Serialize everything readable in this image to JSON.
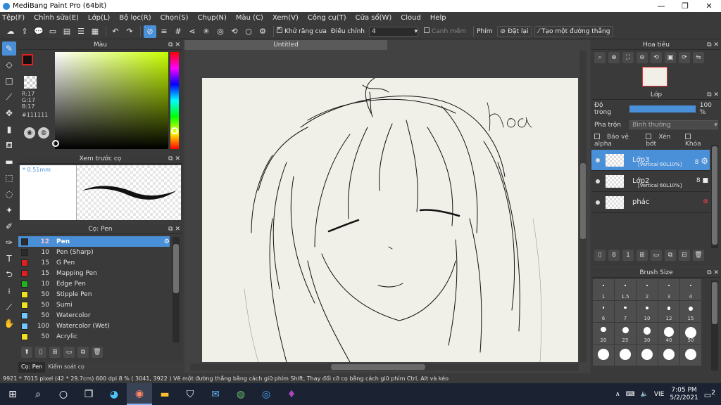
{
  "window": {
    "title": "MediBang Paint Pro (64bit)"
  },
  "menu": [
    "Tệp(F)",
    "Chỉnh sửa(E)",
    "Lớp(L)",
    "Bộ lọc(R)",
    "Chọn(S)",
    "Chụp(N)",
    "Màu (C)",
    "Xem(V)",
    "Công cụ(T)",
    "Cửa sổ(W)",
    "Cloud",
    "Help"
  ],
  "toolbar": {
    "antialias_label": "Khử răng cưa",
    "correction_label": "Điều chỉnh",
    "correction_value": "4",
    "stay_label": "Canh mềm",
    "key_label": "Phím",
    "reset_label": "Đặt lại",
    "line_label": "Tạo một đường thẳng"
  },
  "color_panel": {
    "title": "Màu",
    "r": "R:17",
    "g": "G:17",
    "b": "B:17",
    "hex": "#111111",
    "fg_color": "#111111",
    "bg_color": "#c6d8ff"
  },
  "preview_panel": {
    "title": "Xem trước cọ",
    "size": "* 0.51mm"
  },
  "pen_panel": {
    "title": "Cọ: Pen",
    "items": [
      {
        "num": "12",
        "name": "Pen",
        "color": "#2b2b2b"
      },
      {
        "num": "10",
        "name": "Pen (Sharp)",
        "color": "#2b2b2b"
      },
      {
        "num": "15",
        "name": "G Pen",
        "color": "#e02020"
      },
      {
        "num": "15",
        "name": "Mapping Pen",
        "color": "#e02020"
      },
      {
        "num": "10",
        "name": "Edge Pen",
        "color": "#20b020"
      },
      {
        "num": "50",
        "name": "Stipple Pen",
        "color": "#f0e020"
      },
      {
        "num": "50",
        "name": "Sumi",
        "color": "#f0e020"
      },
      {
        "num": "50",
        "name": "Watercolor",
        "color": "#70c8ff"
      },
      {
        "num": "100",
        "name": "Watercolor (Wet)",
        "color": "#70c8ff"
      },
      {
        "num": "50",
        "name": "Acrylic",
        "color": "#f0e020"
      }
    ]
  },
  "left_tabs": [
    "Cọ: Pen",
    "Kiểm soát cọ"
  ],
  "document": {
    "tab": "Untitled",
    "handwriting": "hoa"
  },
  "navigator": {
    "title": "Hoa tiêu"
  },
  "layer_panel": {
    "title": "Lớp",
    "opacity_label": "Độ trong",
    "opacity_value": "100 %",
    "opacity_fraction": 1.0,
    "blend_label": "Pha trộn",
    "blend_value": "Bình thường",
    "protect_alpha": "Bảo vệ alpha",
    "clipping": "Xén bớt",
    "lock": "Khóa",
    "layers": [
      {
        "name": "Lớp3",
        "sub": "[Vertical 60L10%]",
        "right": "8"
      },
      {
        "name": "Lớp2",
        "sub": "[Vertical 60L10%]",
        "right": "8"
      },
      {
        "name": "phác",
        "sub": "",
        "right": ""
      }
    ]
  },
  "brush_size": {
    "title": "Brush Size",
    "sizes": [
      "1",
      "1.5",
      "2",
      "3",
      "4",
      "6",
      "7",
      "10",
      "12",
      "15",
      "20",
      "25",
      "30",
      "40",
      "50",
      "",
      "",
      "",
      "",
      ""
    ]
  },
  "status": "9921 * 7015 pixel   (42 * 29.7cm)   600 dpi   8 %   ( 3041, 3922 )   Vẽ một đường thẳng bằng cách giữ phím Shift, Thay đổi cỡ cọ bằng cách giữ phím Ctrl, Alt và kéo",
  "taskbar": {
    "lang": "VIE",
    "time": "7:05 PM",
    "date": "5/2/2021",
    "notif": "2"
  }
}
